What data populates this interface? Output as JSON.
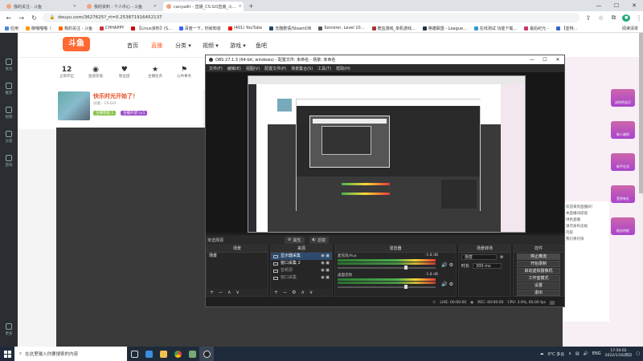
{
  "browser": {
    "tabs": [
      {
        "label": "我的关注 - 斗鱼",
        "active": false
      },
      {
        "label": "我的资料 - 个人中心 - 斗鱼",
        "active": false
      },
      {
        "label": "canyadlr - 直播_CS:GO直播_斗...",
        "active": true
      }
    ],
    "url": "douyu.com/3627625?_rt=0.253871916452137",
    "bookmarks": [
      "应用",
      "御喵喵喵（",
      "我的关注 - 斗鱼",
      "CHHAPPY",
      "【Linux资料】(S...",
      "百度一下，你就知道",
      "(401) YouTube",
      "无删剧情/SteamDB",
      "Sorcerer, Level 10...",
      "爬虫游戏_单机游戏...",
      "英雄联盟 - League...",
      "在线测试 功能下载...",
      "最后纪元 -",
      "【亚特..."
    ],
    "reading_list": "阅读清单",
    "window_controls": [
      "—",
      "☐",
      "✕"
    ]
  },
  "site": {
    "logo": "斗鱼",
    "nav": [
      "首页",
      "直播",
      "分类 ▾",
      "视频 ▾",
      "游戏 ▾",
      "鱼吧"
    ],
    "left_rail": [
      "关注",
      "推荐",
      "视频",
      "分类",
      "游戏",
      "更多"
    ],
    "stats": [
      {
        "num": "12",
        "label": "立即开启"
      },
      {
        "num": "",
        "label": "鱼翅充值"
      },
      {
        "num": "",
        "label": "粉丝团"
      },
      {
        "num": "",
        "label": "主播任务"
      },
      {
        "num": "",
        "label": "公共事务"
      }
    ],
    "streamer_name": "快乐时光开始了！",
    "streamer_tags": [
      "分类：CS:GO",
      "canyadlr"
    ],
    "badge1": "主播等级 1",
    "badge2": "主播声望 Lv1",
    "right_side": [
      "送你的宝贝",
      "新人福利",
      "新手礼包",
      "签到有礼",
      "粉丝特权"
    ],
    "chat_lines": [
      "欢迎来到直播间！",
      "本直播间提倡",
      "绿色直播",
      "请勿发布违规",
      "内容",
      "我们将尽快"
    ]
  },
  "obs": {
    "title": "OBS 27.1.3 (64-bit, windows) - 配置文件: 未命名 - 场景: 未命名",
    "menu": [
      "文件(F)",
      "编辑(E)",
      "视图(V)",
      "配置文件(P)",
      "场景集合(S)",
      "工具(T)",
      "帮助(H)"
    ],
    "preview_status": "未选择源",
    "dock_tabs": [
      "属性",
      "滤镜"
    ],
    "docks": {
      "scenes": {
        "title": "场景",
        "items": [
          "场景"
        ]
      },
      "sources": {
        "title": "来源",
        "items": [
          "显示器采集",
          "窗口采集 2",
          "音频源",
          "窗口采集"
        ]
      },
      "mixer": {
        "title": "混音器",
        "channels": [
          {
            "name": "麦克风/Aux",
            "value": "-1.8 dB",
            "fader": 0.68
          },
          {
            "name": "桌面音频",
            "value": "-1.8 dB",
            "fader": 0.68
          }
        ]
      },
      "transitions": {
        "title": "场景转场",
        "type": "渐变",
        "duration_label": "时长",
        "duration": "300 ms"
      },
      "controls": {
        "title": "控件",
        "buttons": [
          "停止推流",
          "开始录制",
          "启动虚拟摄像机",
          "工作室模式",
          "设置",
          "退出"
        ]
      }
    },
    "status": {
      "live": "LIVE: 00:00:00",
      "rec": "REC: 00:00:00",
      "cpu": "CPU: 3.9%, 60.00 fps"
    },
    "footer_buttons": [
      "+",
      "−",
      "⚙",
      "∧",
      "∨"
    ]
  },
  "taskbar": {
    "search_placeholder": "在这里输入你要搜索的内容",
    "weather": "0°C 多云",
    "lang": "ENG",
    "time": "17:50:02",
    "date": "2022/1/16/周日"
  }
}
